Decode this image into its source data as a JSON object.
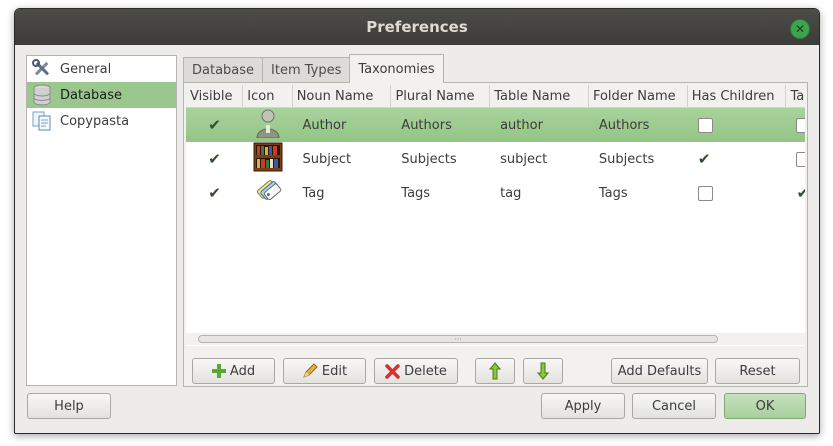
{
  "window": {
    "title": "Preferences"
  },
  "sidebar": {
    "items": [
      {
        "label": "General",
        "icon": "tools-icon"
      },
      {
        "label": "Database",
        "icon": "database-icon",
        "selected": true
      },
      {
        "label": "Copypasta",
        "icon": "documents-icon"
      }
    ]
  },
  "tabs": [
    {
      "label": "Database"
    },
    {
      "label": "Item Types"
    },
    {
      "label": "Taxonomies",
      "active": true
    }
  ],
  "table": {
    "columns": [
      "Visible",
      "Icon",
      "Noun Name",
      "Plural Name",
      "Table Name",
      "Folder Name",
      "Has Children",
      "Ta"
    ],
    "rows": [
      {
        "visible": true,
        "icon": "person-icon",
        "noun": "Author",
        "plural": "Authors",
        "table": "author",
        "folder": "Authors",
        "has_children": false,
        "selected": true
      },
      {
        "visible": true,
        "icon": "bookshelf-icon",
        "noun": "Subject",
        "plural": "Subjects",
        "table": "subject",
        "folder": "Subjects",
        "has_children": true,
        "selected": false
      },
      {
        "visible": true,
        "icon": "tags-icon",
        "noun": "Tag",
        "plural": "Tags",
        "table": "tag",
        "folder": "Tags",
        "has_children": false,
        "selected": false
      }
    ]
  },
  "toolbar": {
    "add_label": "Add",
    "edit_label": "Edit",
    "delete_label": "Delete",
    "add_defaults_label": "Add Defaults",
    "reset_label": "Reset"
  },
  "footer": {
    "help_label": "Help",
    "apply_label": "Apply",
    "cancel_label": "Cancel",
    "ok_label": "OK"
  },
  "colors": {
    "selection": "#9ac78e",
    "titlebar": "#3c3b37",
    "accent_green": "#3ea34e"
  }
}
